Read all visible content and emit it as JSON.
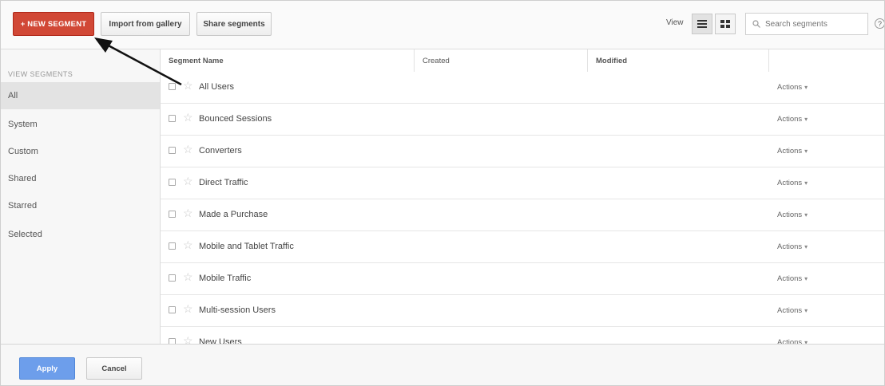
{
  "toolbar": {
    "new_segment_label": "+ NEW SEGMENT",
    "import_label": "Import from gallery",
    "share_label": "Share segments",
    "view_label": "View",
    "search_placeholder": "Search segments",
    "help_label": "?"
  },
  "sidebar": {
    "heading": "VIEW SEGMENTS",
    "items": [
      {
        "label": "All",
        "active": true
      },
      {
        "label": "System"
      },
      {
        "label": "Custom"
      },
      {
        "label": "Shared"
      },
      {
        "label": "Starred"
      },
      {
        "label": "Selected"
      }
    ]
  },
  "table": {
    "columns": [
      "Segment Name",
      "Created",
      "Modified",
      ""
    ],
    "action_label": "Actions",
    "rows": [
      {
        "name": "All Users"
      },
      {
        "name": "Bounced Sessions"
      },
      {
        "name": "Converters"
      },
      {
        "name": "Direct Traffic"
      },
      {
        "name": "Made a Purchase"
      },
      {
        "name": "Mobile and Tablet Traffic"
      },
      {
        "name": "Mobile Traffic"
      },
      {
        "name": "Multi-session Users"
      },
      {
        "name": "New Users"
      }
    ]
  },
  "footer": {
    "apply_label": "Apply",
    "cancel_label": "Cancel"
  },
  "colors": {
    "new_segment": "#d14836",
    "apply": "#6d9eeb"
  },
  "icons": {
    "list_view": "list-view-icon",
    "grid_view": "grid-view-icon",
    "search": "search-icon",
    "star": "star-icon",
    "annotation": "arrow-annotation"
  }
}
